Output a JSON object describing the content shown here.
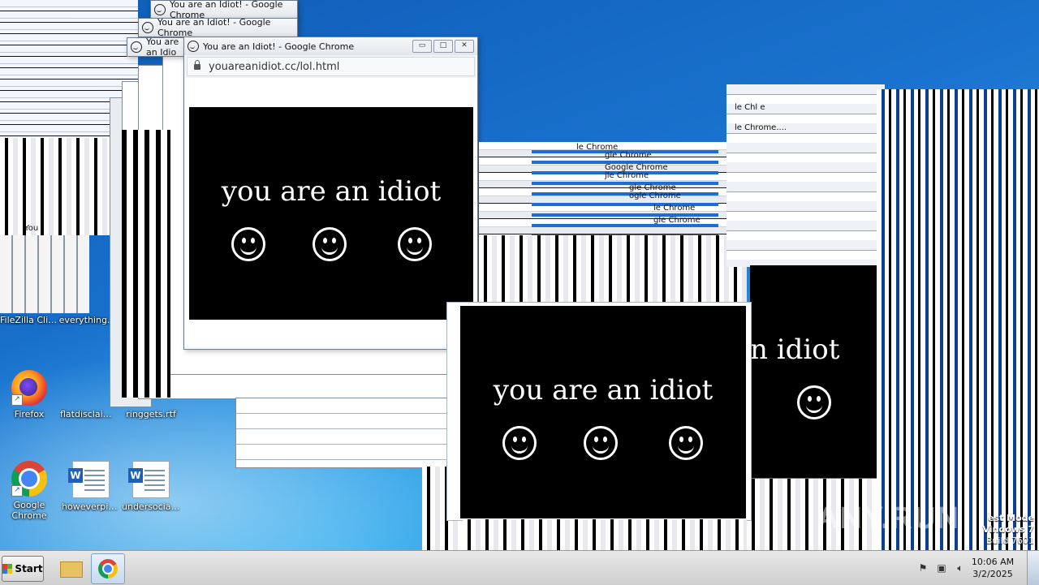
{
  "colors": {
    "desktop": "#1e6fc0",
    "taskbar": "#d6d6d6",
    "prank_bg": "#000000",
    "prank_text": "#ffffff"
  },
  "desktop_icons": [
    {
      "label": "FileZilla Client",
      "icon": "filezilla-icon"
    },
    {
      "label": "everything.",
      "icon": "file-icon"
    },
    {
      "label": "Firefox",
      "icon": "firefox-icon"
    },
    {
      "label": "flatdisclaim...",
      "icon": "file-icon"
    },
    {
      "label": "ringgets.rtf",
      "icon": "word-doc-icon"
    },
    {
      "label": "Google Chrome",
      "icon": "chrome-icon"
    },
    {
      "label": "howeverpin...",
      "icon": "word-doc-icon"
    },
    {
      "label": "undersocial.rtf",
      "icon": "word-doc-icon"
    }
  ],
  "main_window": {
    "title": "You are an Idiot! - Google Chrome",
    "url": "youareanidiot.cc/lol.html",
    "headline": "you are an idiot",
    "minimize": "▭",
    "maximize": "□",
    "close": "✕"
  },
  "stacked_titles": [
    "You are an Idiot! - Google Chrome",
    "You are an Idiot! - Google Chrome",
    "You are an Idio",
    "You"
  ],
  "center_window": {
    "headline": "you are an idiot"
  },
  "right_window": {
    "headline": "n idiot"
  },
  "glitch_text": [
    "le Chrome",
    "gle Chrome",
    "Google Chrome",
    "jle Chrome",
    "gle Chrome",
    "ogle Chrome",
    "le Chrome",
    "le Chl e",
    "le Chrome....",
    "gle Chrome"
  ],
  "watermark": "ANY.RUN",
  "test_mode": {
    "line1": "est Mode",
    "line2": "Vindows 7",
    "line3": "Build 7601"
  },
  "taskbar": {
    "start_label": "Start",
    "clock_time": "10:06 AM",
    "clock_date": "3/2/2025"
  }
}
